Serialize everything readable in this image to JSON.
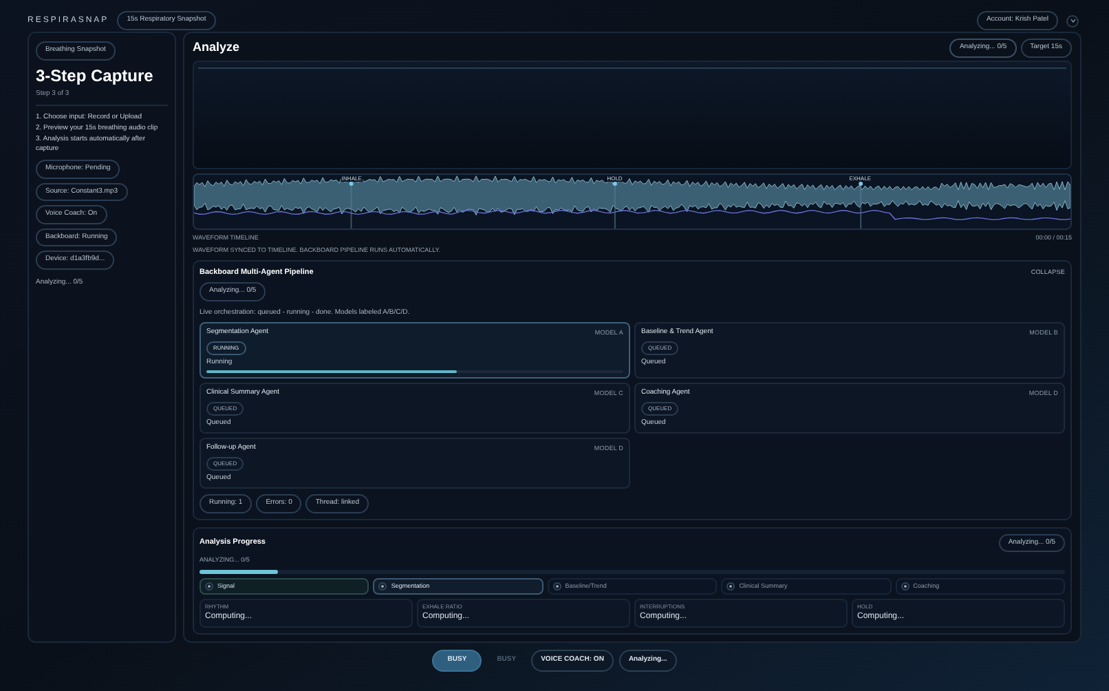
{
  "brand": "RESPIRASNAP",
  "brand_badge": "15s Respiratory Snapshot",
  "account": "Account: Krish Patel",
  "sidebar": {
    "badge": "Breathing Snapshot",
    "title": "3-Step Capture",
    "step": "Step 3 of 3",
    "instructions": [
      "1. Choose input: Record or Upload",
      "2. Preview your 15s breathing audio clip",
      "3. Analysis starts automatically after capture"
    ],
    "chips": [
      "Microphone: Pending",
      "Source: Constant3.mp3",
      "Voice Coach: On",
      "Backboard: Running",
      "Device: d1a3fb9d..."
    ],
    "status": "Analyzing... 0/5"
  },
  "main": {
    "title": "Analyze",
    "pills": [
      "Analyzing... 0/5",
      "Target 15s"
    ],
    "waveform": {
      "markers": [
        "INHALE",
        "HOLD",
        "EXHALE"
      ],
      "label": "WAVEFORM TIMELINE",
      "time": "00:00 / 00:15",
      "note": "WAVEFORM SYNCED TO TIMELINE. BACKBOARD PIPELINE RUNS AUTOMATICALLY."
    },
    "pipeline": {
      "title": "Backboard Multi-Agent Pipeline",
      "badge": "Analyzing... 0/5",
      "collapse": "COLLAPSE",
      "description": "Live orchestration: queued - running - done. Models labeled A/B/C/D.",
      "agents": [
        {
          "name": "Segmentation Agent",
          "model": "MODEL A",
          "badge": "RUNNING",
          "status": "Running",
          "kind": "running",
          "level": 0.6
        },
        {
          "name": "Baseline & Trend Agent",
          "model": "MODEL B",
          "badge": "QUEUED",
          "status": "Queued",
          "kind": "queued"
        },
        {
          "name": "Clinical Summary Agent",
          "model": "MODEL C",
          "badge": "QUEUED",
          "status": "Queued",
          "kind": "queued"
        },
        {
          "name": "Coaching Agent",
          "model": "MODEL D",
          "badge": "QUEUED",
          "status": "Queued",
          "kind": "queued"
        },
        {
          "name": "Follow-up Agent",
          "model": "MODEL D",
          "badge": "QUEUED",
          "status": "Queued",
          "kind": "queued"
        }
      ],
      "stats": [
        "Running: 1",
        "Errors: 0",
        "Thread: linked"
      ]
    },
    "progress": {
      "title": "Analysis Progress",
      "badge": "Analyzing... 0/5",
      "label": "ANALYZING... 0/5",
      "level": 0.09,
      "stages": [
        {
          "label": "Signal",
          "kind": "done"
        },
        {
          "label": "Segmentation",
          "kind": "active"
        },
        {
          "label": "Baseline/Trend",
          "kind": "pending"
        },
        {
          "label": "Clinical Summary",
          "kind": "pending"
        },
        {
          "label": "Coaching",
          "kind": "pending"
        }
      ],
      "metrics": [
        {
          "label": "RHYTHM",
          "value": "Computing..."
        },
        {
          "label": "EXHALE RATIO",
          "value": "Computing..."
        },
        {
          "label": "INTERRUPTIONS",
          "value": "Computing..."
        },
        {
          "label": "HOLD",
          "value": "Computing..."
        }
      ]
    }
  },
  "bottom_bar": [
    {
      "label": "BUSY",
      "kind": "primary"
    },
    {
      "label": "BUSY",
      "kind": "disabled"
    },
    {
      "label": "VOICE COACH: ON",
      "kind": "outline"
    },
    {
      "label": "Analyzing...",
      "kind": "outline"
    }
  ]
}
